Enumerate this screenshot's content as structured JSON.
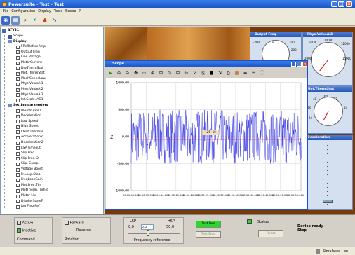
{
  "window": {
    "title": "Powersuite - Test - Test",
    "minimize": "_",
    "maximize": "□",
    "close": "×"
  },
  "menu": [
    "File",
    "Configuration",
    "Display",
    "Tools",
    "Scope",
    "?"
  ],
  "toolbar_icons": [
    "open-icon",
    "save-icon",
    "search-icon",
    "connect-icon",
    "user-icon",
    "arrow-icon"
  ],
  "tree": {
    "root": "ATV31",
    "items": [
      {
        "label": "Scope",
        "type": "node",
        "checked": false
      },
      {
        "label": "Display",
        "type": "group",
        "checked": false
      },
      {
        "label": "FRefBeforeRmp",
        "type": "leaf",
        "checked": false
      },
      {
        "label": "Output Freq",
        "type": "leaf",
        "checked": true
      },
      {
        "label": "Line Voltage",
        "type": "leaf",
        "checked": false
      },
      {
        "label": "MotorCurrent",
        "type": "leaf",
        "checked": true
      },
      {
        "label": "DrvThermStat",
        "type": "leaf",
        "checked": false
      },
      {
        "label": "Mot.ThermStat",
        "type": "leaf",
        "checked": true
      },
      {
        "label": "MachSpeedLow",
        "type": "leaf",
        "checked": true
      },
      {
        "label": "Phys.ValueAI1",
        "type": "leaf",
        "checked": false
      },
      {
        "label": "Phys.ValueAI2",
        "type": "leaf",
        "checked": true
      },
      {
        "label": "Phys.ValueAI3",
        "type": "leaf",
        "checked": false
      },
      {
        "label": "Int.Scale. AO1",
        "type": "leaf",
        "checked": false
      },
      {
        "label": "Setting parameters",
        "type": "group",
        "checked": false
      },
      {
        "label": "Acceleration",
        "type": "leaf",
        "checked": false
      },
      {
        "label": "Deceleration",
        "type": "leaf",
        "checked": true
      },
      {
        "label": "Low Speed",
        "type": "leaf",
        "checked": false
      },
      {
        "label": "High Speed",
        "type": "leaf",
        "checked": true
      },
      {
        "label": "I.Mot.Thermal",
        "type": "leaf",
        "checked": false
      },
      {
        "label": "Acceleration2",
        "type": "leaf",
        "checked": false
      },
      {
        "label": "Deceleration2",
        "type": "leaf",
        "checked": false
      },
      {
        "label": "LSP Timeout",
        "type": "leaf",
        "checked": false
      },
      {
        "label": "Slip Freq.",
        "type": "leaf",
        "checked": false
      },
      {
        "label": "Slip Freq. 2",
        "type": "leaf",
        "checked": false
      },
      {
        "label": "Slip. Comp.",
        "type": "leaf",
        "checked": false
      },
      {
        "label": "Voltage Boost",
        "type": "leaf",
        "checked": false
      },
      {
        "label": "Fr.Loop.Stab.",
        "type": "leaf",
        "checked": false
      },
      {
        "label": "FreqLoopGain",
        "type": "leaf",
        "checked": false
      },
      {
        "label": "Mot.Freq.Thr",
        "type": "leaf",
        "checked": false
      },
      {
        "label": "MotTherm.Thrhld",
        "type": "leaf",
        "checked": false
      },
      {
        "label": "Motor I.lvl",
        "type": "leaf",
        "checked": false
      },
      {
        "label": "DisplayScaleF",
        "type": "leaf",
        "checked": false
      },
      {
        "label": "Jog Freq.Ref",
        "type": "leaf",
        "checked": false
      }
    ]
  },
  "gauges": {
    "output_freq": {
      "title": "Output Freq",
      "ticks": [
        "-200",
        "0",
        "100",
        "200"
      ]
    },
    "phys_value": {
      "title": "Phys.ValueAI2",
      "ticks": [
        "5000",
        "10000",
        "12000",
        "2000",
        "15000"
      ]
    },
    "mot_therm": {
      "title": "Mot.ThermStat",
      "ticks": [
        "60",
        "72",
        "84",
        "48",
        "36",
        "24"
      ]
    },
    "deceleration": {
      "title": "Deceleration"
    }
  },
  "scope": {
    "title": "Scope",
    "tool_icons": [
      "play-icon",
      "zoom-in-icon",
      "zoom-out-icon",
      "pan-icon",
      "rect-icon",
      "crosshair-icon",
      "fit-icon",
      "cursor-icon",
      "hscale-icon",
      "scale-x-icon",
      "scale-y-icon",
      "copy-icon",
      "save-icon",
      "export-icon",
      "print-icon",
      "grid-icon",
      "cursors-icon",
      "settings-icon",
      "info-icon"
    ],
    "marker_label": "125  -50",
    "window_buttons": [
      "_",
      "□",
      "×"
    ]
  },
  "chart_data": {
    "type": "line",
    "ylabel": "Hz",
    "ylim": [
      -1000,
      1000
    ],
    "yticks": [
      "1000.00",
      "500.00",
      "0.00",
      "-500.00",
      "-1000.00"
    ],
    "xticks": [
      "00:00:00.000",
      "00:00:05.000",
      "00:00:10.000",
      "00:00:15.000",
      "00:00:20.000",
      "00:00:25.000",
      "00:00:30.000",
      "00:00:35.000",
      "00:00:40.000",
      "00:00:45.000",
      "00:00:50.000",
      "00:00:55.000"
    ],
    "reference_lines": [
      125,
      -50
    ],
    "series": [
      {
        "color": "#3030e0",
        "x_start_s": 0,
        "x_end_s": 57,
        "noise_range": [
          -500,
          500
        ]
      }
    ],
    "grid": true
  },
  "bottom": {
    "active_label": "Active",
    "inactive_label": "Inactive",
    "command_label": "Command",
    "forward_label": "Forward",
    "reverse_label": "Reverse",
    "rotation_label": "Rotation",
    "lsp_label": "LSP",
    "hsp_label": "HSP",
    "lsp_value": "0.0",
    "ref_value": "0.0",
    "hsp_value": "50.0",
    "freq_ref_label": "Frequency reference",
    "test_run": "Test Run",
    "test_stop": "Test Stop",
    "status_label": "Status",
    "reset_label": "Reset",
    "device_ready": "Device ready",
    "device_state": "Stop"
  },
  "status": {
    "mode": "Simulated",
    "on": "on"
  }
}
